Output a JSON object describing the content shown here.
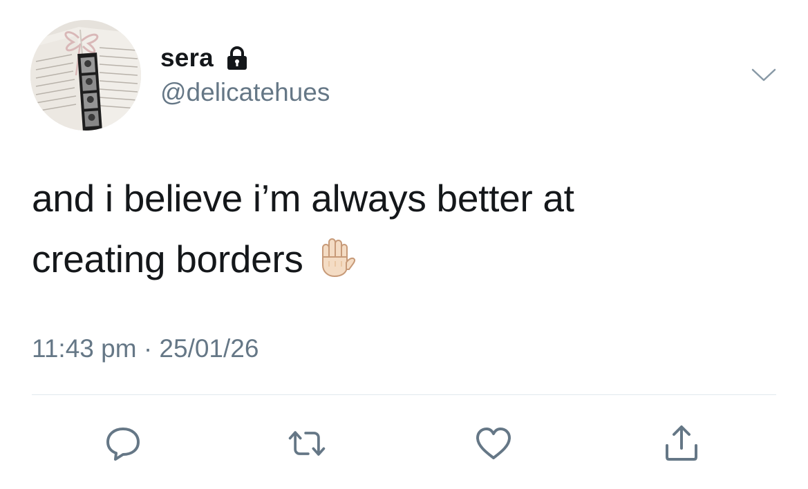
{
  "tweet": {
    "author": {
      "display_name": "sera",
      "handle": "@delicatehues",
      "protected": true
    },
    "text_line1": "and i believe i’m always better at",
    "text_line2": "creating borders",
    "emoji": "raised-hand-light-skin-tone",
    "time": "11:43 pm",
    "separator": "·",
    "date": "25/01/26"
  },
  "icons": {
    "lock": "lock-icon",
    "menu": "chevron-down-icon",
    "reply": "reply-icon",
    "retweet": "retweet-icon",
    "like": "heart-icon",
    "share": "share-icon"
  },
  "colors": {
    "text_primary": "#14171a",
    "text_secondary": "#657786",
    "divider": "#e1e8ed"
  }
}
